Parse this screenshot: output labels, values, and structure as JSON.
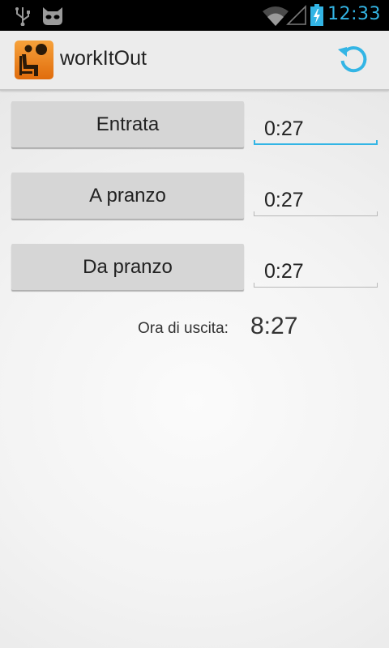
{
  "status_bar": {
    "time": "12:33",
    "icons": [
      "usb-icon",
      "cyanogen-icon",
      "wifi-icon",
      "signal-icon",
      "battery-charging-icon"
    ],
    "accent_color": "#33b5e5"
  },
  "action_bar": {
    "title": "workItOut",
    "app_icon": "seated-person-icon",
    "refresh_icon": "refresh-icon"
  },
  "rows": [
    {
      "button_label": "Entrata",
      "time_value": "0:27",
      "focused": true
    },
    {
      "button_label": "A pranzo",
      "time_value": "0:27",
      "focused": false
    },
    {
      "button_label": "Da pranzo",
      "time_value": "0:27",
      "focused": false
    }
  ],
  "exit": {
    "label": "Ora di uscita:",
    "value": "8:27"
  }
}
